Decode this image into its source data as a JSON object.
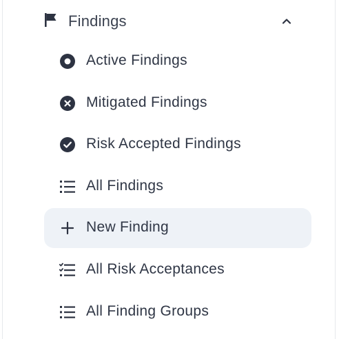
{
  "section": {
    "title": "Findings",
    "icon": "flag-icon",
    "expanded": true,
    "chevron_icon": "chevron-up-icon"
  },
  "items": [
    {
      "label": "Active Findings",
      "icon": "circle-dot-icon"
    },
    {
      "label": "Mitigated Findings",
      "icon": "circle-x-icon"
    },
    {
      "label": "Risk Accepted Findings",
      "icon": "circle-check-icon"
    },
    {
      "label": "All Findings",
      "icon": "list-icon"
    },
    {
      "label": "New Finding",
      "icon": "plus-icon",
      "highlighted": true
    },
    {
      "label": "All Risk Acceptances",
      "icon": "checklist-icon"
    },
    {
      "label": "All Finding Groups",
      "icon": "list-icon"
    }
  ],
  "colors": {
    "text": "#2f3645",
    "icon": "#2d3342",
    "highlight_bg": "#eef2f7"
  }
}
